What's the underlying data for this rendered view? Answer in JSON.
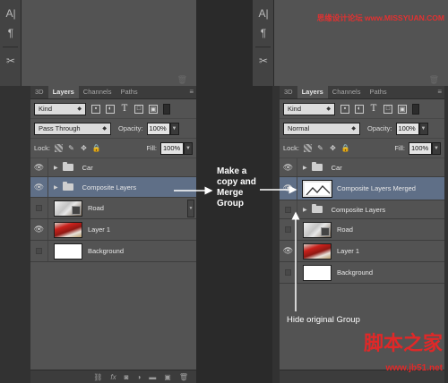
{
  "left_toolstrip": {
    "tool1": "A|",
    "tool2": "¶",
    "tool3": "✂"
  },
  "right_toolstrip": {
    "tool1": "A|",
    "tool2": "¶",
    "tool3": "✂"
  },
  "tabs": [
    "3D",
    "Layers",
    "Channels",
    "Paths"
  ],
  "active_tab": "Layers",
  "filter": {
    "label": "Kind"
  },
  "left_panel": {
    "blend_mode": "Pass Through",
    "opacity_label": "Opacity:",
    "opacity_value": "100%",
    "lock_label": "Lock:",
    "fill_label": "Fill:",
    "fill_value": "100%",
    "layers": [
      {
        "name": "Car",
        "visible": true,
        "type": "group"
      },
      {
        "name": "Composite Layers",
        "visible": true,
        "type": "group",
        "selected": true
      },
      {
        "name": "Road",
        "visible": false,
        "type": "image"
      },
      {
        "name": "Layer 1",
        "visible": true,
        "type": "image"
      },
      {
        "name": "Background",
        "visible": false,
        "type": "image"
      }
    ]
  },
  "right_panel": {
    "blend_mode": "Normal",
    "opacity_label": "Opacity:",
    "opacity_value": "100%",
    "lock_label": "Lock:",
    "fill_label": "Fill:",
    "fill_value": "100%",
    "layers": [
      {
        "name": "Car",
        "visible": true,
        "type": "group"
      },
      {
        "name": "Composite Layers Merged",
        "visible": true,
        "type": "image",
        "selected": true
      },
      {
        "name": "Composite Layers",
        "visible": false,
        "type": "group"
      },
      {
        "name": "Road",
        "visible": false,
        "type": "image"
      },
      {
        "name": "Layer 1",
        "visible": true,
        "type": "image"
      },
      {
        "name": "Background",
        "visible": false,
        "type": "image"
      }
    ]
  },
  "annotations": {
    "merge_note": [
      "Make a",
      "copy and",
      "Merge",
      "Group"
    ],
    "hide_note": "Hide original Group"
  },
  "watermarks": {
    "top": "思缘设计论坛 www.MISSYUAN.COM",
    "bottom_cn": "脚本之家",
    "bottom_url": "www.jb51.net"
  },
  "colors": {
    "selection": "#5f6f87",
    "panel": "#535353",
    "watermark": "#e02828"
  }
}
